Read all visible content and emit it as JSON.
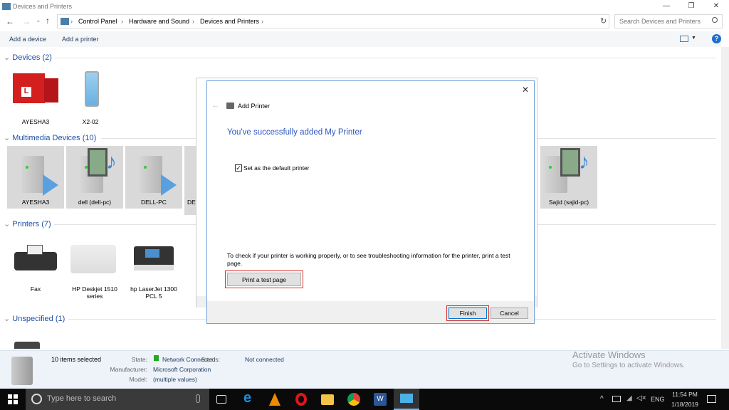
{
  "window": {
    "title": "Devices and Printers",
    "minimize": "—",
    "maximize": "❐",
    "close": "✕"
  },
  "nav": {
    "back": "←",
    "forward": "→",
    "recent": "⌄",
    "up": "↑",
    "refresh": "↻"
  },
  "breadcrumb": [
    "Control Panel",
    "Hardware and Sound",
    "Devices and Printers"
  ],
  "search": {
    "placeholder": "Search Devices and Printers"
  },
  "toolbar": {
    "add_device": "Add a device",
    "add_printer": "Add a printer",
    "help": "?"
  },
  "groups": {
    "devices": {
      "title": "Devices (2)",
      "items": [
        "AYESHA3",
        "X2-02"
      ]
    },
    "multimedia": {
      "title": "Multimedia Devices (10)",
      "items": [
        "AYESHA3",
        "dell (dell-pc)",
        "DELL-PC",
        "DE",
        "Sajid (sajid-pc)"
      ]
    },
    "printers": {
      "title": "Printers (7)",
      "items": [
        "Fax",
        "HP Deskjet 1510 series",
        "hp LaserJet 1300 PCL 5"
      ]
    },
    "unspecified": {
      "title": "Unspecified (1)"
    }
  },
  "details": {
    "selected": "10 items selected",
    "state_label": "State:",
    "state": "Network Connected",
    "status_label": "Status:",
    "status": "Not connected",
    "manufacturer_label": "Manufacturer:",
    "manufacturer": "Microsoft Corporation",
    "model_label": "Model:",
    "model": "(multiple values)"
  },
  "dialog": {
    "title": "Add Printer",
    "heading": "You've successfully added My Printer",
    "default_checkbox": "Set as the default printer",
    "default_checked": true,
    "info": "To check if your printer is working properly, or to see troubleshooting information for the printer, print a test page.",
    "print_test": "Print a test page",
    "finish": "Finish",
    "cancel": "Cancel",
    "close": "✕"
  },
  "watermark": {
    "title": "Activate Windows",
    "subtitle": "Go to Settings to activate Windows."
  },
  "taskbar": {
    "search_placeholder": "Type here to search",
    "lang": "ENG",
    "time": "11:54 PM",
    "date": "1/18/2019"
  },
  "colors": {
    "accent": "#1e50a2",
    "dialog_heading": "#2b56c4",
    "highlight": "#d9322c"
  }
}
